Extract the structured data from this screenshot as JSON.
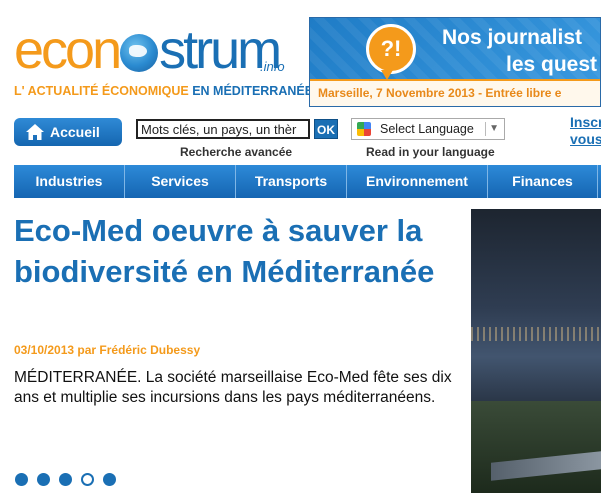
{
  "logo": {
    "word_prefix": "econ",
    "word_suffix": "strum",
    "info": ".info",
    "tagline_part1": "L' ACTUALITÉ ÉCONOMIQUE",
    "tagline_part2": "EN MÉDITERRANÉE"
  },
  "banner": {
    "icon_text": "?!",
    "title_line1": "Nos journalist",
    "title_line2": "les quest",
    "footer": "Marseille, 7 Novembre 2013 - Entrée libre e"
  },
  "toolbar": {
    "home_label": "Accueil",
    "search_value": "Mots clés, un pays, un thèr",
    "search_button": "OK",
    "advanced_search": "Recherche avancée",
    "language_select": "Select Language",
    "language_caption": "Read in your language",
    "signup_line1": "Inscr",
    "signup_line2": "vous"
  },
  "nav": {
    "items": [
      "Industries",
      "Services",
      "Transports",
      "Environnement",
      "Finances"
    ]
  },
  "article": {
    "title": "Eco-Med oeuvre à sauver la biodiversité en Méditerranée",
    "meta": "03/10/2013 par Frédéric Dubessy",
    "lead": "MÉDITERRANÉE. La société marseillaise Eco-Med fête ses dix ans et multiplie ses incursions dans les pays méditerranéens.",
    "slides_total": 5,
    "active_slide": 4
  },
  "colors": {
    "brand_blue": "#1a6fb4",
    "brand_orange": "#f49a1b"
  }
}
